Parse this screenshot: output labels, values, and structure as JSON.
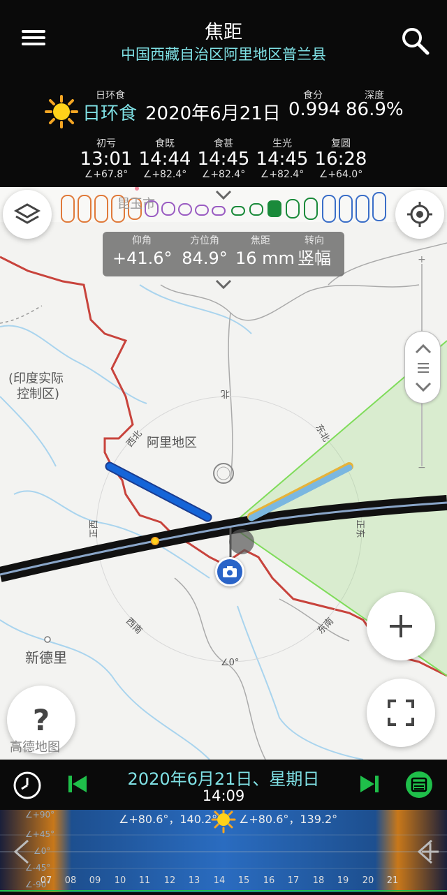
{
  "header": {
    "title": "焦距",
    "location": "中国西藏自治区阿里地区普兰县"
  },
  "eclipse": {
    "type_label": "日环食",
    "type_value": "日环食",
    "date": "2020年6月21日",
    "magnitude_label": "食分",
    "magnitude": "0.994",
    "depth_label": "深度",
    "depth": "86.9%"
  },
  "phases": [
    {
      "label": "初亏",
      "time": "13:01",
      "angle": "∠+67.8°"
    },
    {
      "label": "食既",
      "time": "14:44",
      "angle": "∠+82.4°"
    },
    {
      "label": "食甚",
      "time": "14:45",
      "angle": "∠+82.4°"
    },
    {
      "label": "生光",
      "time": "14:45",
      "angle": "∠+82.4°"
    },
    {
      "label": "复圆",
      "time": "16:28",
      "angle": "∠+64.0°"
    }
  ],
  "panel": {
    "elevation_label": "仰角",
    "elevation": "+41.6°",
    "azimuth_label": "方位角",
    "azimuth": "84.9°",
    "focal_label": "焦距",
    "focal": "16 mm",
    "orientation_label": "转向",
    "orientation": "竖幅"
  },
  "map": {
    "labels": {
      "kunming_faded": "昆玉市",
      "india_control_1": "(印度实际",
      "india_control_2": "控制区)",
      "ali": "阿里地区",
      "xindeli": "新德里",
      "north": "北",
      "northeast": "东北",
      "northwest": "西北",
      "east": "正东",
      "west": "正西",
      "southwest": "西南",
      "southeast": "东南",
      "zero": "∠0°"
    },
    "help_label": "?",
    "watermark": "高德地图"
  },
  "bottom": {
    "date": "2020年6月21日、星期日",
    "time": "14:09",
    "sun_left": "∠+80.6°，140.2°",
    "sun_right": "∠+80.6°，139.2°",
    "hours": [
      "07",
      "08",
      "09",
      "10",
      "11",
      "12",
      "13",
      "14",
      "15",
      "16",
      "17",
      "18",
      "19",
      "20",
      "21"
    ],
    "angle_marks": [
      "∠+90°",
      "∠+45°",
      "∠0°",
      "∠-45°",
      "∠-90°"
    ]
  },
  "colors": {
    "accent_cyan": "#7fe0e4",
    "accent_green": "#1fbf4a",
    "map_bg": "#f3f3f1",
    "border_red": "#c8433c",
    "sun_line_blue": "#1565d8",
    "moon_line_blue": "#7ab7e0",
    "fov_green": "#8bd66b"
  },
  "icons": [
    "menu-icon",
    "search-icon",
    "sun-icon",
    "layers-icon",
    "locate-icon",
    "camera-icon",
    "plus-icon",
    "fullscreen-icon",
    "clock-icon",
    "skip-previous-icon",
    "skip-next-icon",
    "calendar-icon"
  ]
}
